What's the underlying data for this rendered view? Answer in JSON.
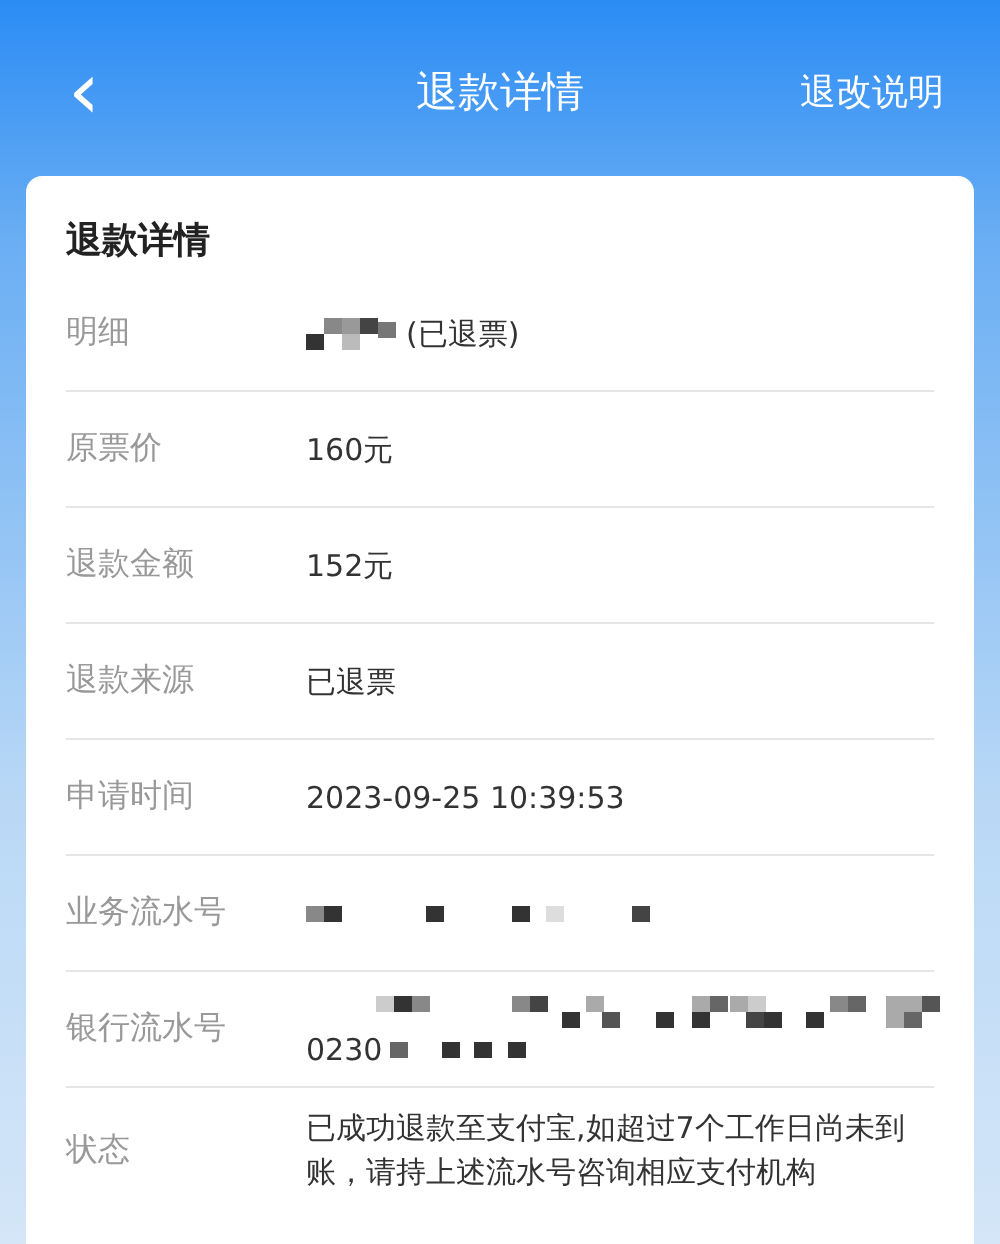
{
  "header": {
    "back": "‹",
    "title": "退款详情",
    "action": "退改说明"
  },
  "card": {
    "title": "退款详情",
    "rows": [
      {
        "label": "明细",
        "kind": "mosaic_before",
        "value": "(已退票)"
      },
      {
        "label": "原票价",
        "kind": "plain",
        "value": "160元"
      },
      {
        "label": "退款金额",
        "kind": "plain",
        "value": "152元"
      },
      {
        "label": "退款来源",
        "kind": "plain",
        "value": "已退票"
      },
      {
        "label": "申请时间",
        "kind": "plain",
        "value": "2023-09-25 10:39:53"
      },
      {
        "label": "业务流水号",
        "kind": "mosaic_only"
      },
      {
        "label": "银行流水号",
        "kind": "mosaic_wrap",
        "value": "0230"
      },
      {
        "label": "状态",
        "kind": "plain",
        "value": "已成功退款至支付宝,如超过7个工作日尚未到账，请持上述流水号咨询相应支付机构"
      }
    ]
  }
}
